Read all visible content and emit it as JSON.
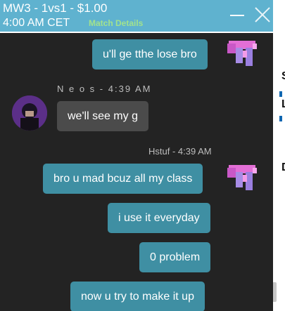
{
  "header": {
    "title": "MW3 - 1vs1 - $1.00",
    "time": "4:00 AM CET",
    "link_label": "Match Details"
  },
  "side_strip": {
    "frag_1": "S",
    "frag_2": "L",
    "frag_3": "D"
  },
  "messages": [
    {
      "text": "u'll ge tthe lose bro",
      "sender": "self"
    },
    {
      "text": "we'll see my g",
      "sender": "other",
      "author": "N e o s",
      "time": "4:39 AM"
    },
    {
      "text": "bro u mad bcuz all my class",
      "sender": "self",
      "author": "Hstuf",
      "time": "4:39 AM"
    },
    {
      "text": "i use it everyday",
      "sender": "self"
    },
    {
      "text": "0 problem",
      "sender": "self"
    },
    {
      "text": "now u try to make it up",
      "sender": "self"
    }
  ],
  "colors": {
    "header_bg": "#5fb2cf",
    "chat_bg": "#232323",
    "outgoing_bubble": "#3f8fa3",
    "incoming_bubble": "#4b4b4b",
    "link": "#a2e28d"
  }
}
